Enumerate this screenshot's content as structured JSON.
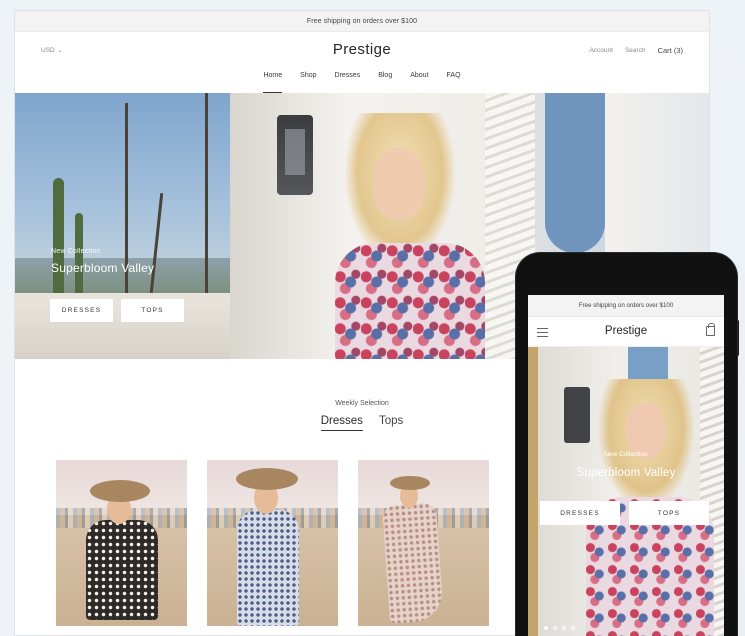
{
  "desktop": {
    "announcement": "Free shipping on orders over $100",
    "currency": "USD",
    "logo": "Prestige",
    "header_links": [
      "Account",
      "Search",
      "Cart (3)"
    ],
    "nav": [
      "Home",
      "Shop",
      "Dresses",
      "Blog",
      "About",
      "FAQ"
    ],
    "active_nav": "Home",
    "hero": {
      "kicker": "New Collection",
      "title": "Superbloom Valley",
      "buttons": [
        "DRESSES",
        "TOPS"
      ]
    },
    "weekly": {
      "kicker": "Weekly Selection",
      "tabs": [
        "Dresses",
        "Tops"
      ],
      "active_tab": "Dresses"
    },
    "products_count_visible": 3
  },
  "mobile": {
    "announcement": "Free shipping on orders over $100",
    "logo": "Prestige",
    "hero": {
      "kicker": "New Collection",
      "title": "Superbloom Valley",
      "buttons": [
        "DRESSES",
        "TOPS"
      ]
    },
    "slides": 4,
    "active_slide": 1
  },
  "icons": {
    "currency_chevron": "chevron-down-icon",
    "mobile_menu": "menu-icon",
    "mobile_cart": "shopping-bag-icon"
  }
}
